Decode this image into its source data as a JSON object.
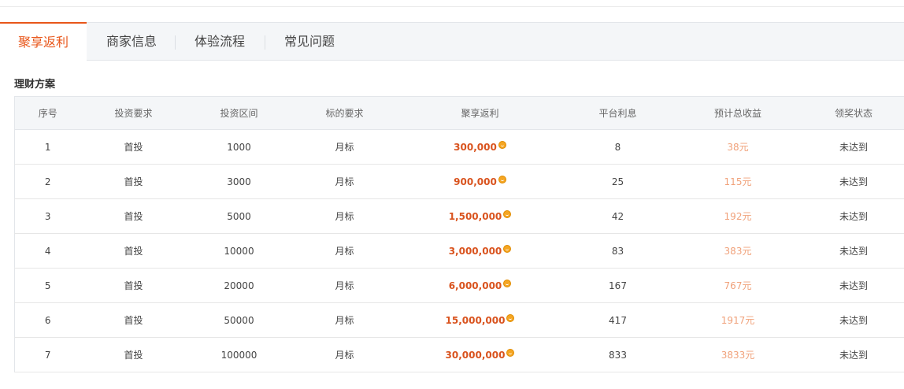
{
  "tabs": [
    {
      "label": "聚享返利",
      "active": true
    },
    {
      "label": "商家信息",
      "active": false
    },
    {
      "label": "体验流程",
      "active": false
    },
    {
      "label": "常见问题",
      "active": false
    }
  ],
  "section_title": "理财方案",
  "table": {
    "headers": [
      "序号",
      "投资要求",
      "投资区间",
      "标的要求",
      "聚享返利",
      "平台利息",
      "预计总收益",
      "领奖状态"
    ],
    "rows": [
      [
        "1",
        "首投",
        "1000",
        "月标",
        "300,000",
        "8",
        "38元",
        "未达到"
      ],
      [
        "2",
        "首投",
        "3000",
        "月标",
        "900,000",
        "25",
        "115元",
        "未达到"
      ],
      [
        "3",
        "首投",
        "5000",
        "月标",
        "1,500,000",
        "42",
        "192元",
        "未达到"
      ],
      [
        "4",
        "首投",
        "10000",
        "月标",
        "3,000,000",
        "83",
        "383元",
        "未达到"
      ],
      [
        "5",
        "首投",
        "20000",
        "月标",
        "6,000,000",
        "167",
        "767元",
        "未达到"
      ],
      [
        "6",
        "首投",
        "50000",
        "月标",
        "15,000,000",
        "417",
        "1917元",
        "未达到"
      ],
      [
        "7",
        "首投",
        "100000",
        "月标",
        "30,000,000",
        "833",
        "3833元",
        "未达到"
      ]
    ]
  },
  "colors": {
    "accent": "#e8561a",
    "rebate": "#d9531e",
    "total": "#f0a17a",
    "coin": "#f5a623"
  },
  "icons": {
    "rebate_unit": "coin-icon"
  }
}
